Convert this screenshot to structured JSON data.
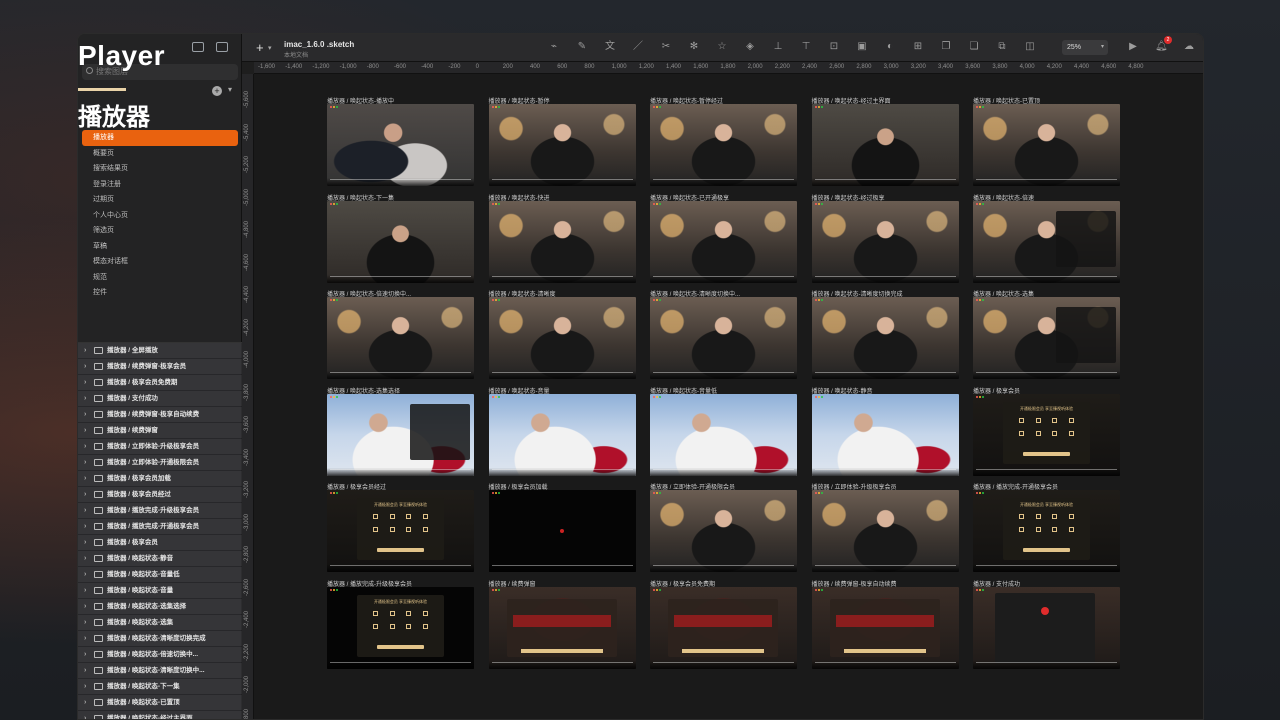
{
  "hero": {
    "title": "Player",
    "subtitle": "播放器"
  },
  "window": {
    "doc_title": "imac_1.6.0 .sketch",
    "doc_subtitle": "本地文档",
    "zoom": "25%",
    "notification_count": "2"
  },
  "sidebar": {
    "search_placeholder": "搜索图层",
    "pages": [
      {
        "label": "播放器",
        "active": true
      },
      {
        "label": "概要页"
      },
      {
        "label": "搜索结果页"
      },
      {
        "label": "登录注册"
      },
      {
        "label": "过期页"
      },
      {
        "label": "个人中心页"
      },
      {
        "label": "筛选页"
      },
      {
        "label": "草稿"
      },
      {
        "label": "模态对话框"
      },
      {
        "label": "规范"
      },
      {
        "label": "控件"
      }
    ],
    "layers": [
      "播放器 / 全屏播放",
      "播放器 / 续费弹窗-极享会员",
      "播放器 / 极享会员免费期",
      "播放器 / 支付成功",
      "播放器 / 续费弹窗-极享自动续费",
      "播放器 / 续费弹窗",
      "播放器 / 立即体验-升级极享会员",
      "播放器 / 立即体验-开通极限会员",
      "播放器 / 极享会员加载",
      "播放器 / 极享会员经过",
      "播放器 / 播放完成-升级极享会员",
      "播放器 / 播放完成-开通极享会员",
      "播放器 / 极享会员",
      "播放器 / 唤起状态-静音",
      "播放器 / 唤起状态-音量低",
      "播放器 / 唤起状态-音量",
      "播放器 / 唤起状态-选集选择",
      "播放器 / 唤起状态-选集",
      "播放器 / 唤起状态-清晰度切换完成",
      "播放器 / 唤起状态-倍速切换中...",
      "播放器 / 唤起状态-清晰度切换中...",
      "播放器 / 唤起状态-下一集",
      "播放器 / 唤起状态-已置顶",
      "播放器 / 唤起状态-经过主界面"
    ]
  },
  "rulers": {
    "top": [
      "-1,600",
      "-1,400",
      "-1,200",
      "-1,000",
      "-800",
      "-600",
      "-400",
      "-200",
      "0",
      "200",
      "400",
      "600",
      "800",
      "1,000",
      "1,200",
      "1,400",
      "1,600",
      "1,800",
      "2,000",
      "2,200",
      "2,400",
      "2,600",
      "2,800",
      "3,000",
      "3,200",
      "3,400",
      "3,600",
      "3,800",
      "4,000",
      "4,200",
      "4,400",
      "4,600",
      "4,800"
    ],
    "left": [
      "-5,600",
      "-5,400",
      "-5,200",
      "-5,000",
      "-4,800",
      "-4,600",
      "-4,400",
      "-4,200",
      "-4,000",
      "-3,800",
      "-3,600",
      "-3,400",
      "-3,200",
      "-3,000",
      "-2,800",
      "-2,600",
      "-2,400",
      "-2,200",
      "-2,000",
      "-1,800"
    ]
  },
  "artboards": [
    {
      "title": "播放器 / 唤起状态-播放中",
      "scene": "alt"
    },
    {
      "title": "播放器 / 唤起状态-暂停",
      "scene": ""
    },
    {
      "title": "播放器 / 唤起状态-暂停经过",
      "scene": ""
    },
    {
      "title": "播放器 / 唤起状态-经过主界面",
      "scene": "dark2"
    },
    {
      "title": "播放器 / 唤起状态-已置顶",
      "scene": ""
    },
    {
      "title": "播放器 / 唤起状态-下一集",
      "scene": "dark2"
    },
    {
      "title": "播放器 / 唤起状态-快进",
      "scene": ""
    },
    {
      "title": "播放器 / 唤起状态-已开通极享",
      "scene": ""
    },
    {
      "title": "播放器 / 唤起状态-经过极享",
      "scene": ""
    },
    {
      "title": "播放器 / 唤起状态-倍速",
      "scene": "",
      "panel": true
    },
    {
      "title": "播放器 / 唤起状态-倍速切换中...",
      "scene": ""
    },
    {
      "title": "播放器 / 唤起状态-清晰度",
      "scene": ""
    },
    {
      "title": "播放器 / 唤起状态-清晰度切换中...",
      "scene": ""
    },
    {
      "title": "播放器 / 唤起状态-清晰度切换完成",
      "scene": ""
    },
    {
      "title": "播放器 / 唤起状态-选集",
      "scene": "",
      "panel": true
    },
    {
      "title": "播放器 / 唤起状态-选集选择",
      "scene": "snow",
      "panel": true
    },
    {
      "title": "播放器 / 唤起状态-音量",
      "scene": "snow"
    },
    {
      "title": "播放器 / 唤起状态-音量低",
      "scene": "snow"
    },
    {
      "title": "播放器 / 唤起状态-静音",
      "scene": "snow"
    },
    {
      "title": "播放器 / 极享会员",
      "scene": "vip",
      "vip": true
    },
    {
      "title": "播放器 / 极享会员经过",
      "scene": "vip",
      "vip": true
    },
    {
      "title": "播放器 / 极享会员加载",
      "scene": "black",
      "loading": true
    },
    {
      "title": "播放器 / 立即体验-开通极限会员",
      "scene": ""
    },
    {
      "title": "播放器 / 立即体验-升级极享会员",
      "scene": ""
    },
    {
      "title": "播放器 / 播放完成-开通极享会员",
      "scene": "vip",
      "vip": true
    },
    {
      "title": "播放器 / 播放完成-升级极享会员",
      "scene": "black",
      "vip": true
    },
    {
      "title": "播放器 / 续费弹窗",
      "scene": "promo",
      "promo": true
    },
    {
      "title": "播放器 / 极享会员免费期",
      "scene": "promo",
      "promo": true
    },
    {
      "title": "播放器 / 续费弹窗-极享自动续费",
      "scene": "promo",
      "promo": true
    },
    {
      "title": "播放器 / 支付成功",
      "scene": "promo",
      "success": true
    }
  ],
  "vip_panel_text": "开通极限会员 享至臻视听体验",
  "colors": {
    "accent": "#e9620f",
    "gold": "#e2c48a",
    "badge": "#e02c2c"
  }
}
